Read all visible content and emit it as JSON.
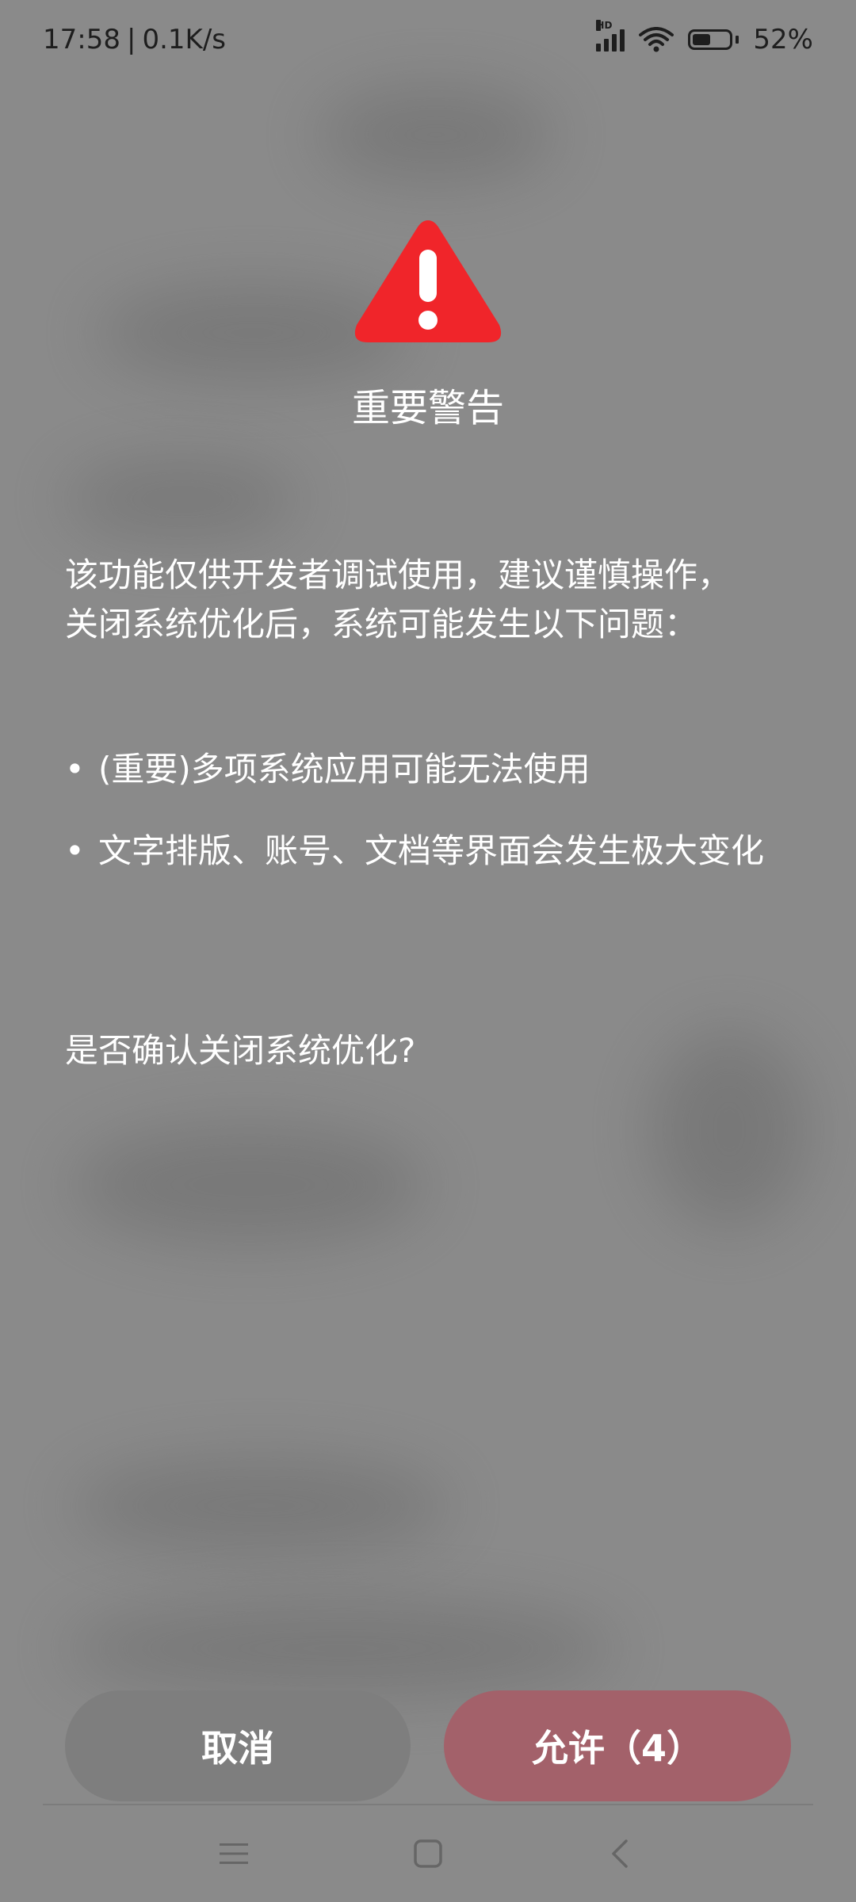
{
  "status_bar": {
    "time": "17:58",
    "separator": "|",
    "net_speed": "0.1K/s",
    "signal_label": "HD",
    "battery_percent": 52,
    "battery_text": "52%"
  },
  "dialog": {
    "icon": "warning-triangle-icon",
    "icon_color": "#f0252a",
    "title": "重要警告",
    "description_line1": "该功能仅供开发者调试使用，建议谨慎操作，",
    "description_line2": "关闭系统优化后，系统可能发生以下问题：",
    "bullets": [
      "(重要)多项系统应用可能无法使用",
      "文字排版、账号、文档等界面会发生极大变化"
    ],
    "bullet_symbol": "•",
    "question": "是否确认关闭系统优化?",
    "cancel_label": "取消",
    "allow_label": "允许（4）"
  },
  "nav_bar": {
    "menu_icon": "menu-icon",
    "home_icon": "home-icon",
    "back_icon": "back-icon"
  },
  "colors": {
    "overlay": "#8a8a8a",
    "cancel": "#7e7e7e",
    "allow": "#a3616a"
  }
}
